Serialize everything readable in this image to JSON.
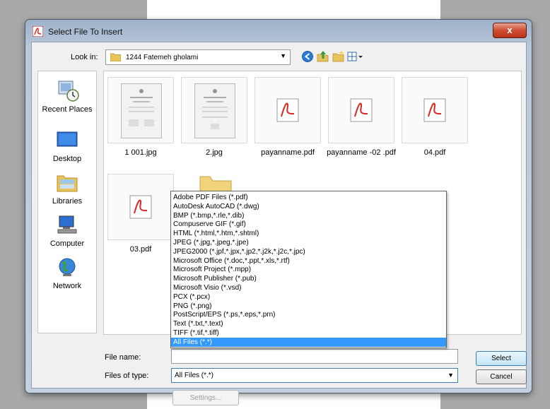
{
  "dialog": {
    "title": "Select File To Insert",
    "close_label": "x"
  },
  "lookin": {
    "label": "Look in:",
    "value": "1244 Fatemeh gholami"
  },
  "toolbar": {
    "icons": [
      "back-icon",
      "up-folder-icon",
      "new-folder-icon",
      "view-menu-icon"
    ]
  },
  "places": [
    {
      "label": "Recent Places",
      "icon": "recent-places-icon"
    },
    {
      "label": "Desktop",
      "icon": "desktop-icon"
    },
    {
      "label": "Libraries",
      "icon": "libraries-icon"
    },
    {
      "label": "Computer",
      "icon": "computer-icon"
    },
    {
      "label": "Network",
      "icon": "network-icon"
    }
  ],
  "files": [
    {
      "name": "1 001.jpg",
      "type": "image"
    },
    {
      "name": "2.jpg",
      "type": "image"
    },
    {
      "name": "payanname.pdf",
      "type": "pdf"
    },
    {
      "name": "payanname -02 .pdf",
      "type": "pdf"
    },
    {
      "name": "04.pdf",
      "type": "pdf"
    },
    {
      "name": "03.pdf",
      "type": "pdf"
    },
    {
      "name": "",
      "type": "folder"
    }
  ],
  "filename": {
    "label": "File name:",
    "value": ""
  },
  "filetype": {
    "label": "Files of type:",
    "value": "All Files (*.*)",
    "options": [
      "Adobe PDF Files (*.pdf)",
      "AutoDesk AutoCAD (*.dwg)",
      "BMP (*.bmp,*.rle,*.dib)",
      "Compuserve GIF (*.gif)",
      "HTML (*.html,*.htm,*.shtml)",
      "JPEG (*.jpg,*.jpeg,*.jpe)",
      "JPEG2000 (*.jpf,*.jpx,*.jp2,*.j2k,*.j2c,*.jpc)",
      "Microsoft Office (*.doc,*.ppt,*.xls,*.rtf)",
      "Microsoft Project (*.mpp)",
      "Microsoft Publisher (*.pub)",
      "Microsoft Visio (*.vsd)",
      "PCX (*.pcx)",
      "PNG (*.png)",
      "PostScript/EPS (*.ps,*.eps,*.prn)",
      "Text (*.txt,*.text)",
      "TIFF (*.tif,*.tiff)",
      "All Files (*.*)"
    ],
    "selected_index": 16
  },
  "buttons": {
    "select": "Select",
    "cancel": "Cancel",
    "settings": "Settings..."
  },
  "colors": {
    "selection": "#3399ff",
    "pdf_red": "#d7261e"
  }
}
